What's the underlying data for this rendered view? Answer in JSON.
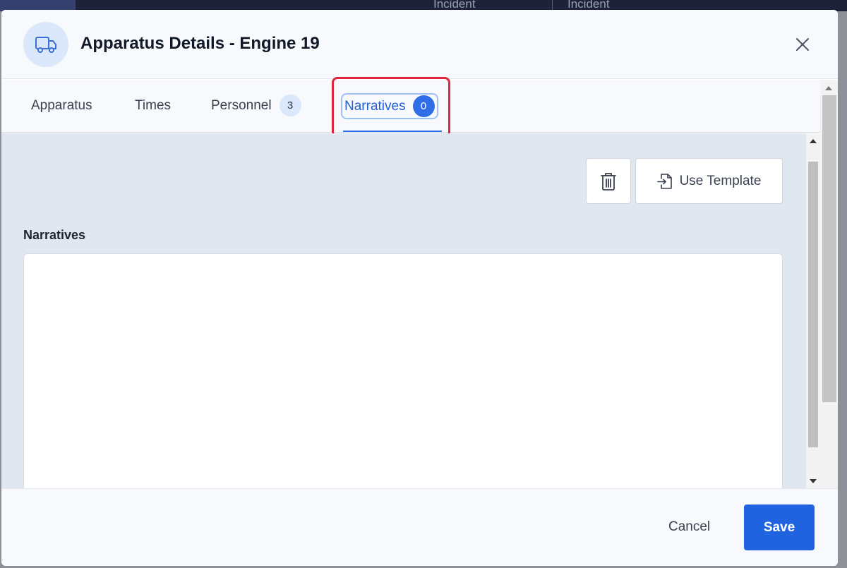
{
  "background": {
    "text_left": "Incident",
    "text_right": "Incident"
  },
  "header": {
    "icon": "truck-icon",
    "title": "Apparatus Details - Engine 19",
    "close_icon": "close-icon"
  },
  "tabs": [
    {
      "label": "Apparatus",
      "count": null,
      "active": false
    },
    {
      "label": "Times",
      "count": null,
      "active": false
    },
    {
      "label": "Personnel",
      "count": "3",
      "active": false
    },
    {
      "label": "Narratives",
      "count": "0",
      "active": true
    }
  ],
  "toolbar": {
    "delete_icon": "trash-icon",
    "template_icon": "file-import-icon",
    "template_label": "Use Template"
  },
  "narratives": {
    "label": "Narratives",
    "value": ""
  },
  "footer": {
    "cancel_label": "Cancel",
    "save_label": "Save"
  },
  "colors": {
    "accent": "#1f63e0",
    "highlight": "#e0253e",
    "content_bg": "#e1e7f0"
  }
}
